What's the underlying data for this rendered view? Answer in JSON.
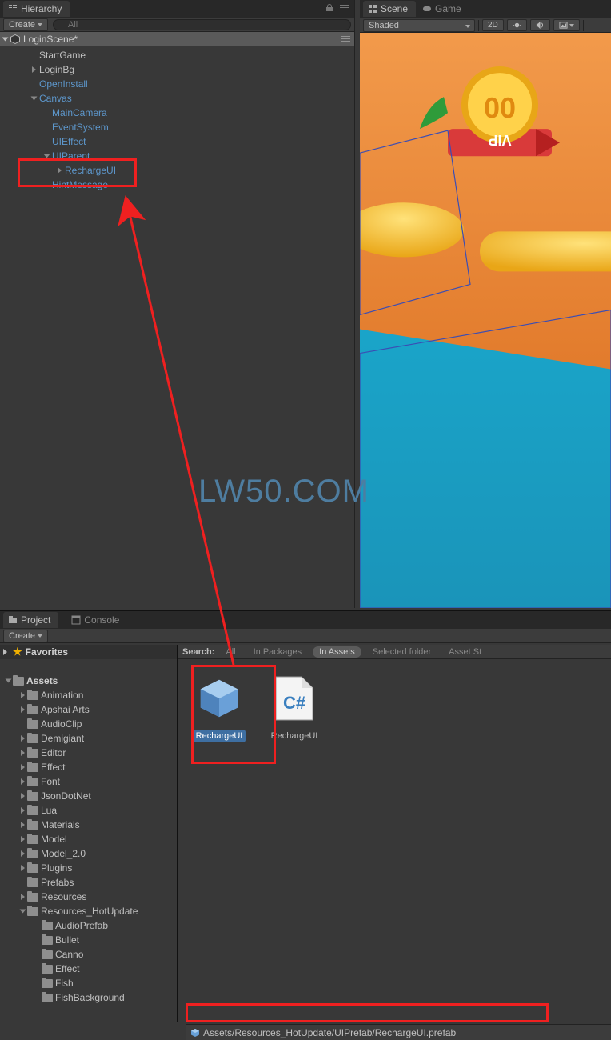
{
  "hierarchy": {
    "tab": "Hierarchy",
    "create": "Create",
    "search_placeholder": "All",
    "scene_name": "LoginScene*",
    "items": {
      "start_game": "StartGame",
      "login_bg": "LoginBg",
      "open_install": "OpenInstall",
      "canvas": "Canvas",
      "main_camera": "MainCamera",
      "event_system": "EventSystem",
      "ui_effect": "UIEffect",
      "ui_parent": "UIParent",
      "recharge_ui": "RechargeUI",
      "hint_message": "HintMessage"
    }
  },
  "scene": {
    "tab_scene": "Scene",
    "tab_game": "Game",
    "shaded": "Shaded",
    "btn_2d": "2D"
  },
  "project": {
    "tab_project": "Project",
    "tab_console": "Console",
    "create": "Create",
    "favorites": "Favorites",
    "assets": "Assets",
    "folders": {
      "animation": "Animation",
      "apshai": "Apshai Arts",
      "audioclip": "AudioClip",
      "demigiant": "Demigiant",
      "editor": "Editor",
      "effect": "Effect",
      "font": "Font",
      "jsondotnet": "JsonDotNet",
      "lua": "Lua",
      "materials": "Materials",
      "model": "Model",
      "model20": "Model_2.0",
      "plugins": "Plugins",
      "prefabs": "Prefabs",
      "resources": "Resources",
      "res_hot": "Resources_HotUpdate",
      "audioprefab": "AudioPrefab",
      "bullet": "Bullet",
      "canno": "Canno",
      "effect2": "Effect",
      "fish": "Fish",
      "fishbg": "FishBackground"
    },
    "search_label": "Search:",
    "scopes": {
      "all": "All",
      "in_packages": "In Packages",
      "in_assets": "In Assets",
      "selected": "Selected folder",
      "store": "Asset St"
    },
    "assets_list": {
      "recharge_prefab": "RechargeUI",
      "recharge_script": "RechargeUI",
      "cs": "C#"
    },
    "path": "Assets/Resources_HotUpdate/UIPrefab/RechargeUI.prefab"
  },
  "watermark": "LW50.COM"
}
